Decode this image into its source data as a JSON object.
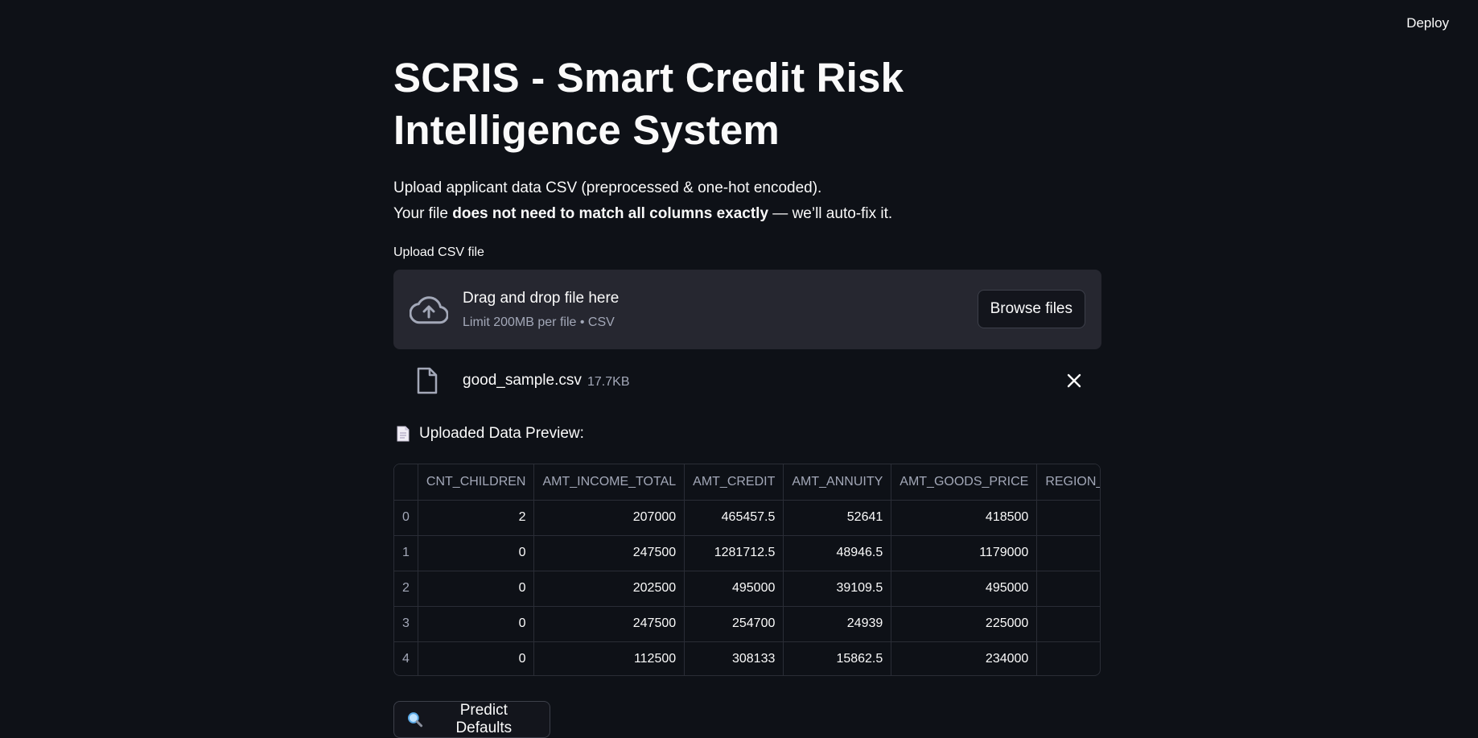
{
  "header": {
    "deploy_label": "Deploy"
  },
  "page": {
    "title": "SCRIS - Smart Credit Risk Intelligence System",
    "intro_line1": "Upload applicant data CSV (preprocessed & one-hot encoded).",
    "intro_line2_prefix": "Your file ",
    "intro_line2_bold": "does not need to match all columns exactly",
    "intro_line2_suffix": " — we’ll auto-fix it."
  },
  "uploader": {
    "label": "Upload CSV file",
    "drop_title": "Drag and drop file here",
    "drop_subtitle": "Limit 200MB per file • CSV",
    "browse_label": "Browse files",
    "file_name": "good_sample.csv",
    "file_size": "17.7KB"
  },
  "preview": {
    "heading": "Uploaded Data Preview:",
    "columns": [
      "",
      "CNT_CHILDREN",
      "AMT_INCOME_TOTAL",
      "AMT_CREDIT",
      "AMT_ANNUITY",
      "AMT_GOODS_PRICE",
      "REGION_PO"
    ],
    "rows": [
      [
        "0",
        "2",
        "207000",
        "465457.5",
        "52641",
        "418500",
        ""
      ],
      [
        "1",
        "0",
        "247500",
        "1281712.5",
        "48946.5",
        "1179000",
        ""
      ],
      [
        "2",
        "0",
        "202500",
        "495000",
        "39109.5",
        "495000",
        ""
      ],
      [
        "3",
        "0",
        "247500",
        "254700",
        "24939",
        "225000",
        ""
      ],
      [
        "4",
        "0",
        "112500",
        "308133",
        "15862.5",
        "234000",
        ""
      ]
    ]
  },
  "actions": {
    "predict_label": "Predict Defaults"
  },
  "icons": {
    "upload": "cloud-upload-icon",
    "file": "file-icon",
    "close": "close-icon",
    "doc": "document-emoji-icon",
    "search": "magnifier-icon"
  },
  "colors": {
    "background": "#0e1117",
    "surface": "#262730",
    "text": "#fafafa",
    "muted": "#a3a8b8",
    "border": "#2a2d36"
  }
}
